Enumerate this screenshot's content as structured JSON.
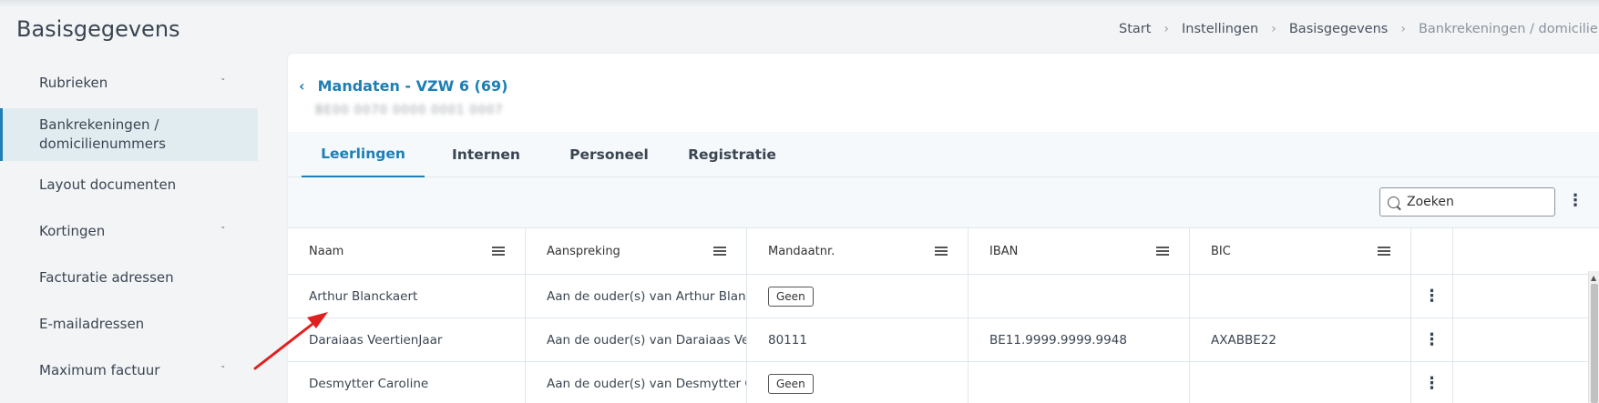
{
  "page": {
    "title": "Basisgegevens"
  },
  "breadcrumb": {
    "items": [
      "Start",
      "Instellingen",
      "Basisgegevens"
    ],
    "current": "Bankrekeningen / domicilienummer"
  },
  "sidebar": {
    "items": [
      {
        "label": "Rubrieken",
        "expandable": true
      },
      {
        "label_line1": "Bankrekeningen /",
        "label_line2": "domicilienummers",
        "active": true
      },
      {
        "label": "Layout documenten"
      },
      {
        "label": "Kortingen",
        "expandable": true
      },
      {
        "label": "Facturatie adressen"
      },
      {
        "label": "E-mailadressen"
      },
      {
        "label": "Maximum factuur",
        "expandable": true
      }
    ]
  },
  "mandaat": {
    "title": "Mandaten - VZW 6 (69)",
    "account_id_blurred": "BE00 0070 0000 0001 0007"
  },
  "tabs": [
    {
      "label": "Leerlingen",
      "active": true
    },
    {
      "label": "Internen"
    },
    {
      "label": "Personeel"
    },
    {
      "label": "Registratie"
    }
  ],
  "search": {
    "placeholder": "Zoeken"
  },
  "table": {
    "columns": [
      "Naam",
      "Aanspreking",
      "Mandaatnr.",
      "IBAN",
      "BIC"
    ],
    "rows": [
      {
        "naam": "Arthur Blanckaert",
        "aanspreking": "Aan de ouder(s) van Arthur Blanc...",
        "mandaatnr": "Geen",
        "mandaat_is_badge": true,
        "iban": "",
        "bic": ""
      },
      {
        "naam": "Daraiaas VeertienJaar",
        "aanspreking": "Aan de ouder(s) van Daraiaas Vee...",
        "mandaatnr": "80111",
        "mandaat_is_badge": false,
        "iban": "BE11.9999.9999.9948",
        "bic": "AXABBE22"
      },
      {
        "naam": "Desmytter Caroline",
        "aanspreking": "Aan de ouder(s) van Desmytter C...",
        "mandaatnr": "Geen",
        "mandaat_is_badge": true,
        "iban": "",
        "bic": ""
      }
    ]
  },
  "colors": {
    "accent": "#1d7fb3",
    "active_bg": "#e1ecf1",
    "annotation_arrow": "#e02020"
  },
  "icons": [
    "chevron-down-icon",
    "chevron-left-icon",
    "chevron-right-icon",
    "search-icon",
    "column-menu-icon",
    "kebab-menu-icon",
    "annotation-arrow"
  ]
}
